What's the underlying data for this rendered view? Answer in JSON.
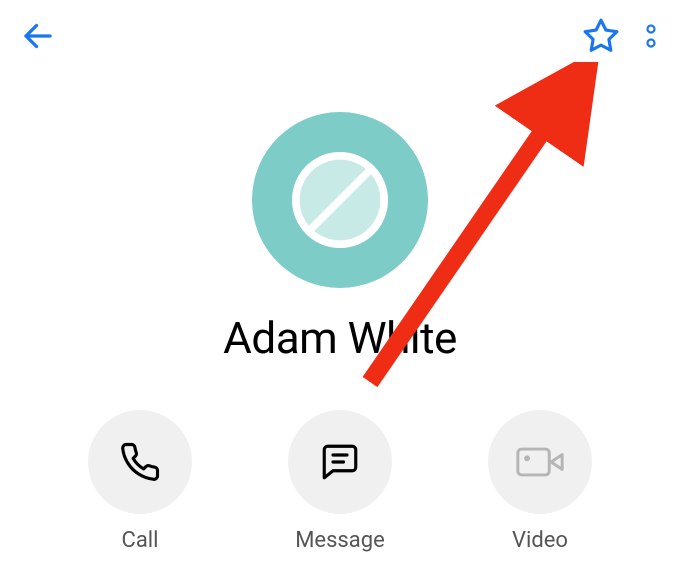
{
  "colors": {
    "primary": "#1976f0",
    "red": "#ef2d15",
    "avatarOuter": "#7dccc8",
    "avatarInner": "#c7eae7",
    "actionBg": "#f0f0f0",
    "textSecondary": "#555555"
  },
  "header": {
    "back_icon": "back-arrow",
    "favorite_icon": "star-outline",
    "menu_icon": "more-vertical"
  },
  "contact": {
    "name": "Adam White"
  },
  "actions": {
    "call": {
      "label": "Call",
      "icon": "phone"
    },
    "message": {
      "label": "Message",
      "icon": "message-square"
    },
    "video": {
      "label": "Video",
      "icon": "video-camera"
    }
  },
  "annotation": {
    "arrow_target": "more-menu"
  }
}
